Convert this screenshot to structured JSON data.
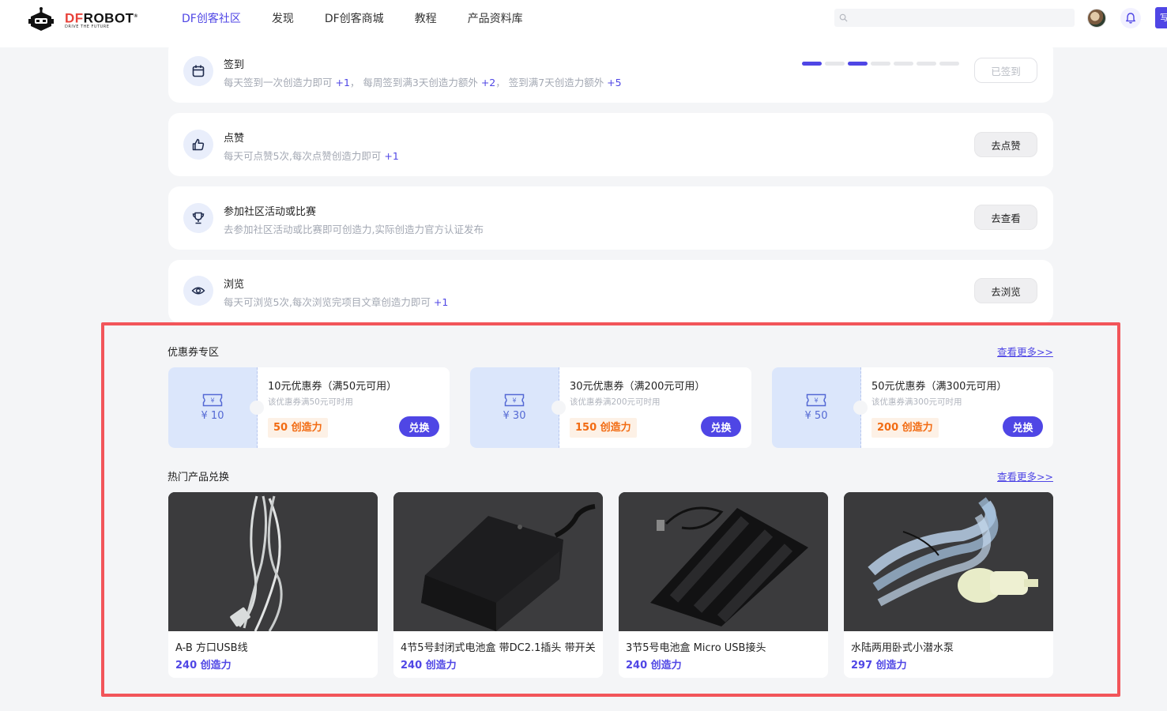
{
  "header": {
    "logo_text_main": "DFROBOT",
    "logo_text_sub": "DRIVE THE FUTURE",
    "nav": [
      {
        "label": "DF创客社区",
        "active": true
      },
      {
        "label": "发现",
        "active": false
      },
      {
        "label": "DF创客商城",
        "active": false
      },
      {
        "label": "教程",
        "active": false
      },
      {
        "label": "产品资料库",
        "active": false
      }
    ],
    "search_placeholder": "",
    "side_button_label": "写"
  },
  "tasks": [
    {
      "title": "签到",
      "desc_parts": [
        "每天签到一次创造力即可 ",
        "+1",
        "， 每周签到满3天创造力额外 ",
        "+2",
        "， 签到满7天创造力额外 ",
        "+5"
      ],
      "button": "已签到",
      "icon": "calendar-icon",
      "progress": [
        true,
        false,
        true,
        false,
        false,
        false,
        false
      ]
    },
    {
      "title": "点赞",
      "desc_parts": [
        "每天可点赞5次,每次点赞创造力即可 ",
        "+1"
      ],
      "button": "去点赞",
      "icon": "thumbs-up-icon"
    },
    {
      "title": "参加社区活动或比赛",
      "desc_parts": [
        "去参加社区活动或比赛即可创造力,实际创造力官方认证发布"
      ],
      "button": "去查看",
      "icon": "trophy-icon"
    },
    {
      "title": "浏览",
      "desc_parts": [
        "每天可浏览5次,每次浏览完项目文章创造力即可 ",
        "+1"
      ],
      "button": "去浏览",
      "icon": "eye-icon"
    }
  ],
  "coupons_section": {
    "title": "优惠券专区",
    "more": "查看更多>>",
    "items": [
      {
        "amount": "¥ 10",
        "name": "10元优惠券（满50元可用）",
        "condition": "该优惠券满50元可时用",
        "cost": "50 创造力",
        "button": "兑换"
      },
      {
        "amount": "¥ 30",
        "name": "30元优惠券（满200元可用）",
        "condition": "该优惠券满200元可时用",
        "cost": "150 创造力",
        "button": "兑换"
      },
      {
        "amount": "¥ 50",
        "name": "50元优惠券（满300元可用）",
        "condition": "该优惠券满300元可时用",
        "cost": "200 创造力",
        "button": "兑换"
      }
    ]
  },
  "products_section": {
    "title": "热门产品兑换",
    "more": "查看更多>>",
    "items": [
      {
        "name": "A-B 方口USB线",
        "cost": "240 创造力"
      },
      {
        "name": "4节5号封闭式电池盒 带DC2.1插头 带开关",
        "cost": "240 创造力"
      },
      {
        "name": "3节5号电池盒 Micro USB接头",
        "cost": "240 创造力"
      },
      {
        "name": "水陆两用卧式小潜水泵",
        "cost": "297 创造力"
      }
    ]
  },
  "colors": {
    "accent": "#4f46e5",
    "highlight_border": "#f2555a",
    "cost_orange": "#f26b12"
  }
}
